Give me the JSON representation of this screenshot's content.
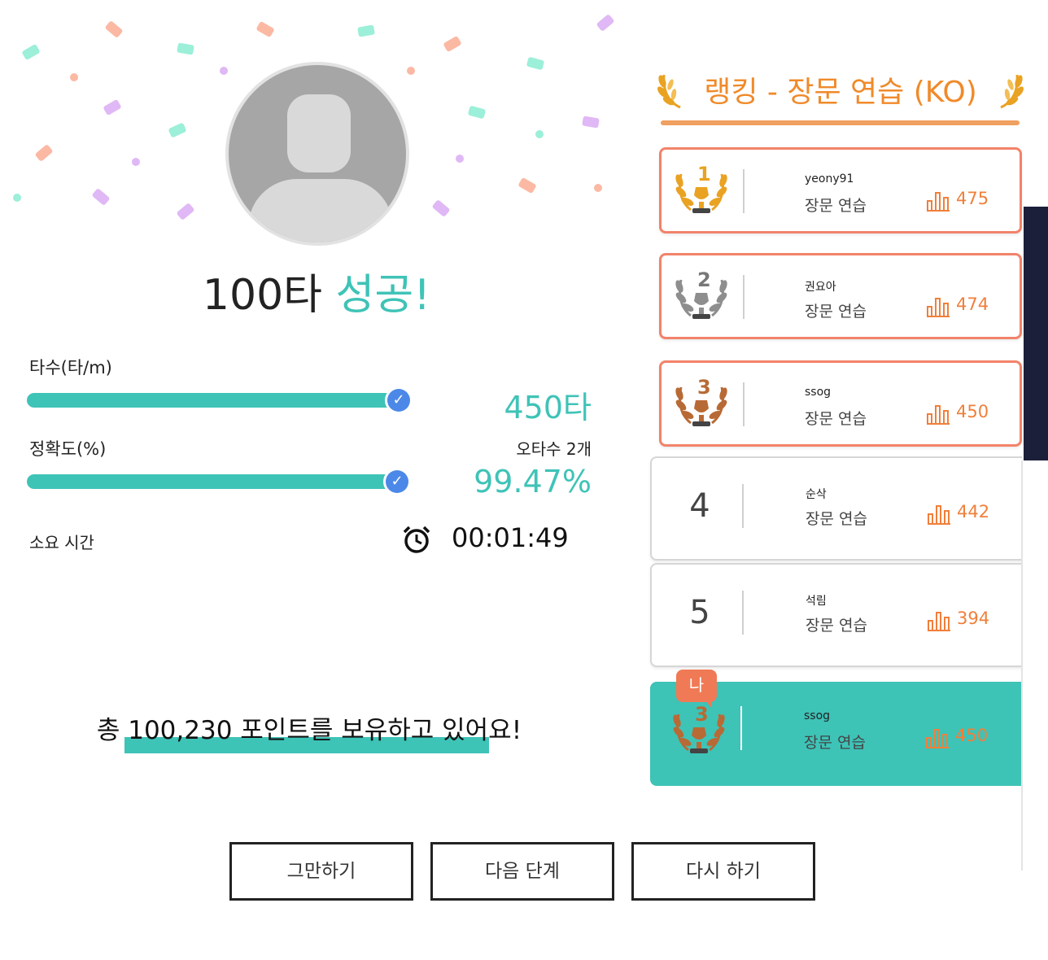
{
  "result": {
    "speed_label": "100타",
    "success_label": "성공!"
  },
  "stats": {
    "speed_title": "타수(타/m)",
    "speed_value": "450타",
    "speed_progress": 1.0,
    "accuracy_title": "정확도(%)",
    "typo_count": "오타수 2개",
    "accuracy_value": "99.47%",
    "accuracy_progress": 1.0,
    "time_title": "소요 시간",
    "time_value": "00:01:49"
  },
  "points_message": "총 100,230 포인트를 보유하고 있어요!",
  "buttons": {
    "stop": "그만하기",
    "next": "다음 단계",
    "retry": "다시 하기"
  },
  "ranking": {
    "title": "랭킹 - 장문 연습 (KO)",
    "entries": [
      {
        "rank": "1",
        "name": "yeony91",
        "mode": "장문 연습",
        "score": "475"
      },
      {
        "rank": "2",
        "name": "권요아",
        "mode": "장문 연습",
        "score": "474"
      },
      {
        "rank": "3",
        "name": "ssog",
        "mode": "장문 연습",
        "score": "450"
      },
      {
        "rank": "4",
        "name": "순삭",
        "mode": "장문 연습",
        "score": "442"
      },
      {
        "rank": "5",
        "name": "석림",
        "mode": "장문 연습",
        "score": "394"
      }
    ],
    "me": {
      "badge": "나",
      "rank": "3",
      "name": "ssog",
      "mode": "장문 연습",
      "score": "450"
    }
  },
  "colors": {
    "accent": "#3ec3b7",
    "ranking_orange": "#f07f3a",
    "gold": "#e9a222",
    "silver": "#8e8e8e",
    "bronze": "#b86a35"
  }
}
